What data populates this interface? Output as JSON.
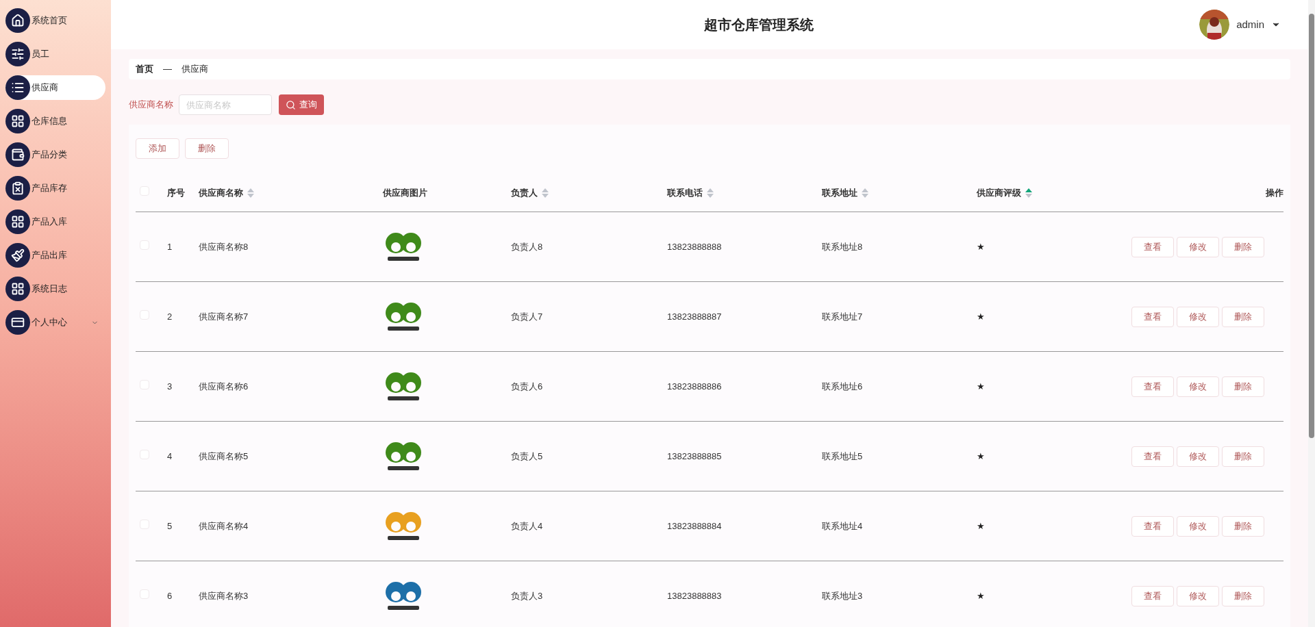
{
  "header": {
    "title": "超市仓库管理系统",
    "user": "admin"
  },
  "sidebar": {
    "items": [
      {
        "label": "系统首页",
        "selected": false
      },
      {
        "label": "员工",
        "selected": false
      },
      {
        "label": "供应商",
        "selected": true
      },
      {
        "label": "仓库信息",
        "selected": false
      },
      {
        "label": "产品分类",
        "selected": false
      },
      {
        "label": "产品库存",
        "selected": false
      },
      {
        "label": "产品入库",
        "selected": false
      },
      {
        "label": "产品出库",
        "selected": false
      },
      {
        "label": "系统日志",
        "selected": false
      },
      {
        "label": "个人中心",
        "selected": false,
        "expanded": false
      }
    ]
  },
  "breadcrumb": [
    "首页",
    "—",
    "供应商"
  ],
  "search": {
    "label": "供应商名称",
    "placeholder": "供应商名称",
    "button": "查询"
  },
  "actions": [
    "添加",
    "删除"
  ],
  "table": {
    "select_all": {
      "checked": false
    },
    "columns": [
      {
        "label": "序号",
        "kind": "plain"
      },
      {
        "label": "供应商名称",
        "kind": "sortable",
        "sorted_ascending": false
      },
      {
        "label": "供应商图片",
        "kind": "plain"
      },
      {
        "label": "负责人",
        "kind": "sortable",
        "sorted_ascending": false
      },
      {
        "label": "联系电话",
        "kind": "sortable",
        "sorted_ascending": false
      },
      {
        "label": "联系地址",
        "kind": "sortable",
        "sorted_ascending": false
      },
      {
        "label": "供应商评级",
        "kind": "sortable",
        "sorted_ascending": true
      },
      {
        "label": "操作",
        "kind": "plain"
      }
    ],
    "rows": [
      {
        "checked": false,
        "index": "1",
        "name": "供应商名称8",
        "contact": "负责人8",
        "phone": "13823888888",
        "address": "联系地址8",
        "rating": "★",
        "buttons": [
          "查看",
          "修改",
          "删除"
        ]
      },
      {
        "checked": false,
        "index": "2",
        "name": "供应商名称7",
        "contact": "负责人7",
        "phone": "13823888887",
        "address": "联系地址7",
        "rating": "★",
        "buttons": [
          "查看",
          "修改",
          "删除"
        ]
      },
      {
        "checked": false,
        "index": "3",
        "name": "供应商名称6",
        "contact": "负责人6",
        "phone": "13823888886",
        "address": "联系地址6",
        "rating": "★",
        "buttons": [
          "查看",
          "修改",
          "删除"
        ]
      },
      {
        "checked": false,
        "index": "4",
        "name": "供应商名称5",
        "contact": "负责人5",
        "phone": "13823888885",
        "address": "联系地址5",
        "rating": "★",
        "buttons": [
          "查看",
          "修改",
          "删除"
        ]
      },
      {
        "checked": false,
        "index": "5",
        "name": "供应商名称4",
        "contact": "负责人4",
        "phone": "13823888884",
        "address": "联系地址4",
        "rating": "★",
        "buttons": [
          "查看",
          "修改",
          "删除"
        ]
      },
      {
        "checked": false,
        "index": "6",
        "name": "供应商名称3",
        "contact": "负责人3",
        "phone": "13823888883",
        "address": "联系地址3",
        "rating": "★",
        "buttons": [
          "查看",
          "修改",
          "删除"
        ]
      }
    ]
  }
}
